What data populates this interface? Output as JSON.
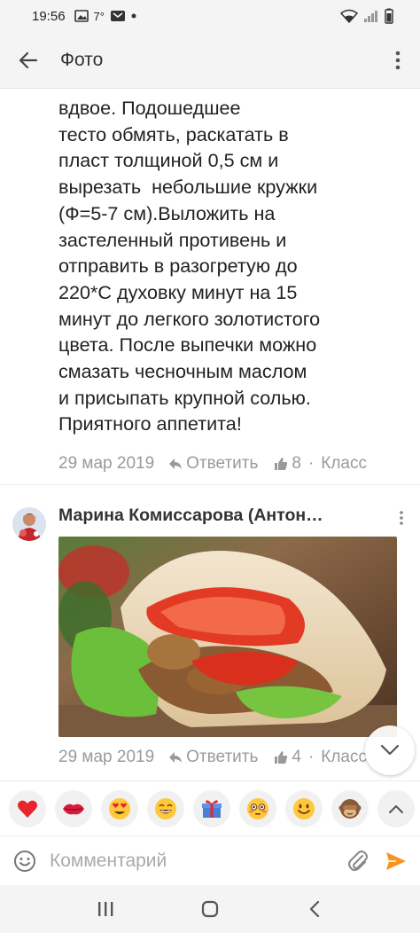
{
  "status_bar": {
    "time": "19:56",
    "temperature": "7°"
  },
  "app_bar": {
    "title": "Фото"
  },
  "comments": [
    {
      "text_lines": [
        "вдвое. Подошедшее",
        "тесто обмять, раскатать в",
        "пласт толщиной 0,5 см и",
        "вырезать  небольшие кружки",
        "(Ф=5-7 см).Выложить на",
        "застеленный противень и",
        "отправить в разогретую до",
        "220*С духовку минут на 15",
        "минут до легкого золотистого",
        "цвета. После выпечки можно",
        "смазать чесночным маслом",
        "и присыпать крупной солью.",
        "Приятного аппетита!"
      ],
      "date": "29 мар 2019",
      "reply_label": "Ответить",
      "likes": "8",
      "like_label": "Класс"
    },
    {
      "author": "Марина Комиссарова (Антон…",
      "date": "29 мар 2019",
      "reply_label": "Ответить",
      "likes": "4",
      "like_label": "Класс"
    }
  ],
  "emoji_bar": {
    "items": [
      "heart",
      "lips-kiss",
      "heart-eyes",
      "laughing",
      "gift",
      "flushed",
      "smiling",
      "monkey-see-no-evil"
    ]
  },
  "comment_input": {
    "placeholder": "Комментарий"
  },
  "colors": {
    "accent": "#f7931e",
    "meta_text": "#9a9a9a",
    "background": "#ffffff",
    "bar": "#f4f4f4"
  }
}
